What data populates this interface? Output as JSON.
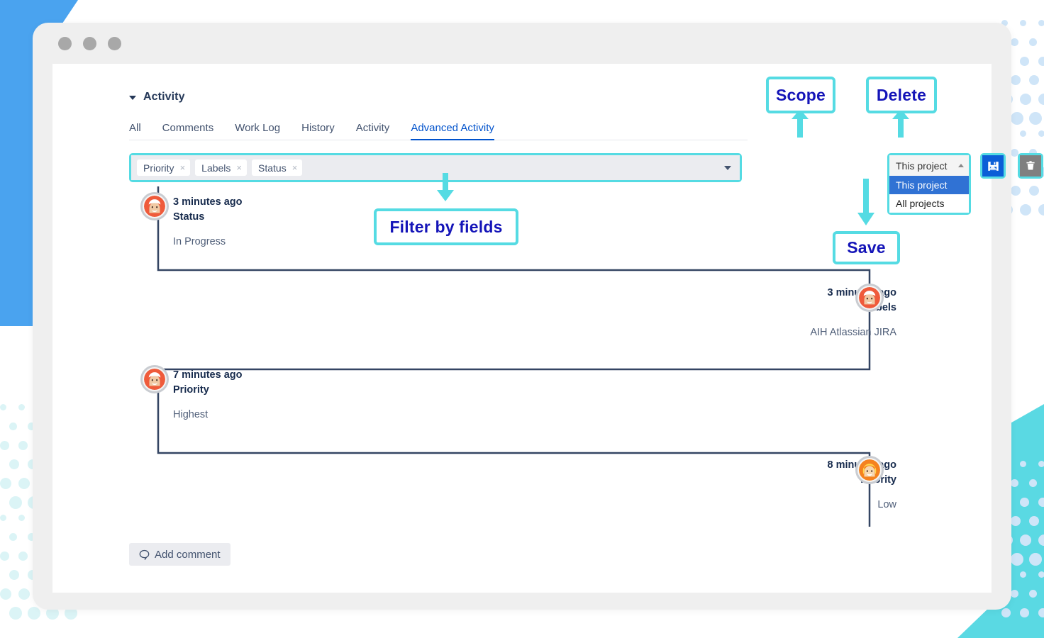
{
  "window": {
    "traffic_dots": 3
  },
  "section": {
    "title": "Activity",
    "collapse_icon": "chevron-down-icon"
  },
  "tabs": [
    {
      "label": "All",
      "active": false
    },
    {
      "label": "Comments",
      "active": false
    },
    {
      "label": "Work Log",
      "active": false
    },
    {
      "label": "History",
      "active": false
    },
    {
      "label": "Activity",
      "active": false
    },
    {
      "label": "Advanced Activity",
      "active": true
    }
  ],
  "filter": {
    "chips": [
      {
        "label": "Priority",
        "remove_icon": "close-icon",
        "remove_glyph": "×"
      },
      {
        "label": "Labels",
        "remove_icon": "close-icon",
        "remove_glyph": "×"
      },
      {
        "label": "Status",
        "remove_icon": "close-icon",
        "remove_glyph": "×"
      }
    ],
    "dropdown_icon": "chevron-down-icon"
  },
  "scope": {
    "selected": "This project",
    "caret_icon": "caret-up-icon",
    "options": [
      {
        "label": "This project",
        "selected": true
      },
      {
        "label": "All projects",
        "selected": false
      }
    ]
  },
  "actions": {
    "save": {
      "label": "Save",
      "icon": "save-floppy-icon",
      "color": "#0b5ed7"
    },
    "delete": {
      "label": "Delete",
      "icon": "trash-icon",
      "color": "#808080"
    }
  },
  "callouts": [
    {
      "id": "scope",
      "label": "Scope"
    },
    {
      "id": "delete",
      "label": "Delete"
    },
    {
      "id": "filter",
      "label": "Filter by fields"
    },
    {
      "id": "save",
      "label": "Save"
    }
  ],
  "activity": [
    {
      "side": "left",
      "when": "3 minutes ago",
      "field": "Status",
      "value": "In Progress",
      "avatar": "avatar-red-white-hair"
    },
    {
      "side": "right",
      "when": "3 minutes ago",
      "field": "Labels",
      "value": "AIH Atlassian JIRA",
      "avatar": "avatar-red-white-hair"
    },
    {
      "side": "left",
      "when": "7 minutes ago",
      "field": "Priority",
      "value": "Highest",
      "avatar": "avatar-red-white-hair"
    },
    {
      "side": "right",
      "when": "8 minutes ago",
      "field": "Priority",
      "value": "Low",
      "avatar": "avatar-orange-blonde-hair"
    }
  ],
  "add_comment": {
    "label": "Add comment",
    "icon": "comment-bubble-icon"
  },
  "colors": {
    "accent_cyan": "#55dbe3",
    "callout_text": "#1414b8",
    "link_blue": "#0052cc",
    "timeline_line": "#344563",
    "deco_blue": "#4aa3ef",
    "deco_cyan": "#5ad9e3"
  }
}
